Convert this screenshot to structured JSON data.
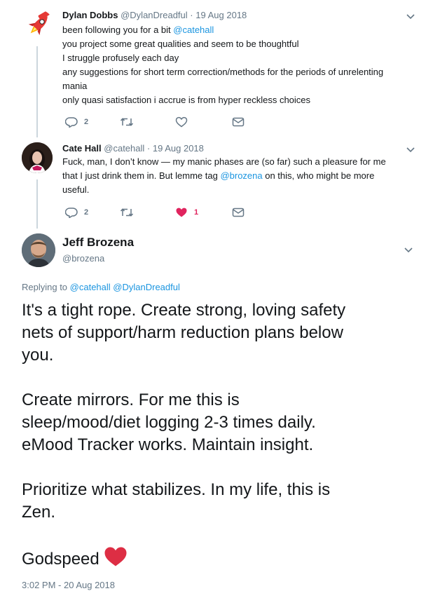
{
  "tweet1": {
    "name": "Dylan Dobbs",
    "handle": "@DylanDreadful",
    "sep": "·",
    "date": "19 Aug 2018",
    "line1_text": "been following you for a bit ",
    "line1_mention": "@catehall",
    "lines": [
      "you project some great qualities and seem to be thoughtful",
      "I struggle profusely each day",
      "any suggestions for short term correction/methods for the periods of unrelenting",
      "mania",
      "only quasi satisfaction i accrue is from hyper reckless choices"
    ],
    "reply_count": "2",
    "retweet_count": "",
    "like_count": "",
    "avatar_icon": "rocket-icon"
  },
  "tweet2": {
    "name": "Cate Hall",
    "handle": "@catehall",
    "sep": "·",
    "date": "19 Aug 2018",
    "line1": "Fuck, man, I don’t know — my manic phases are (so far) such a pleasure for me",
    "line2_pre": "that I just drink them in. But lemme tag ",
    "line2_mention": "@brozena",
    "line2_post": " on this, who might be more",
    "line3": "useful.",
    "reply_count": "2",
    "retweet_count": "",
    "like_count": "1",
    "liked": true
  },
  "tweet3": {
    "name": "Jeff Brozena",
    "handle": "@brozena",
    "replying_prefix": "Replying to ",
    "replying_to_1": "@catehall",
    "replying_to_2": "@DylanDreadful",
    "paragraphs": [
      [
        "It's a tight rope. Create strong, loving safety",
        "nets of support/harm reduction plans below",
        "you."
      ],
      [
        "Create mirrors. For me this is",
        "sleep/mood/diet logging 2-3 times daily.",
        "eMood Tracker works. Maintain insight."
      ],
      [
        "Prioritize what stabilizes. In my life, this is",
        "Zen."
      ]
    ],
    "closing": "Godspeed",
    "closing_emoji": "red-heart-icon",
    "timestamp": "3:02 PM - 20 Aug 2018"
  },
  "colors": {
    "link": "#1b95e0",
    "meta": "#657786",
    "like_red": "#e0245e",
    "heart_emoji": "#dd2e44",
    "thread_line": "#ccd6dd"
  }
}
